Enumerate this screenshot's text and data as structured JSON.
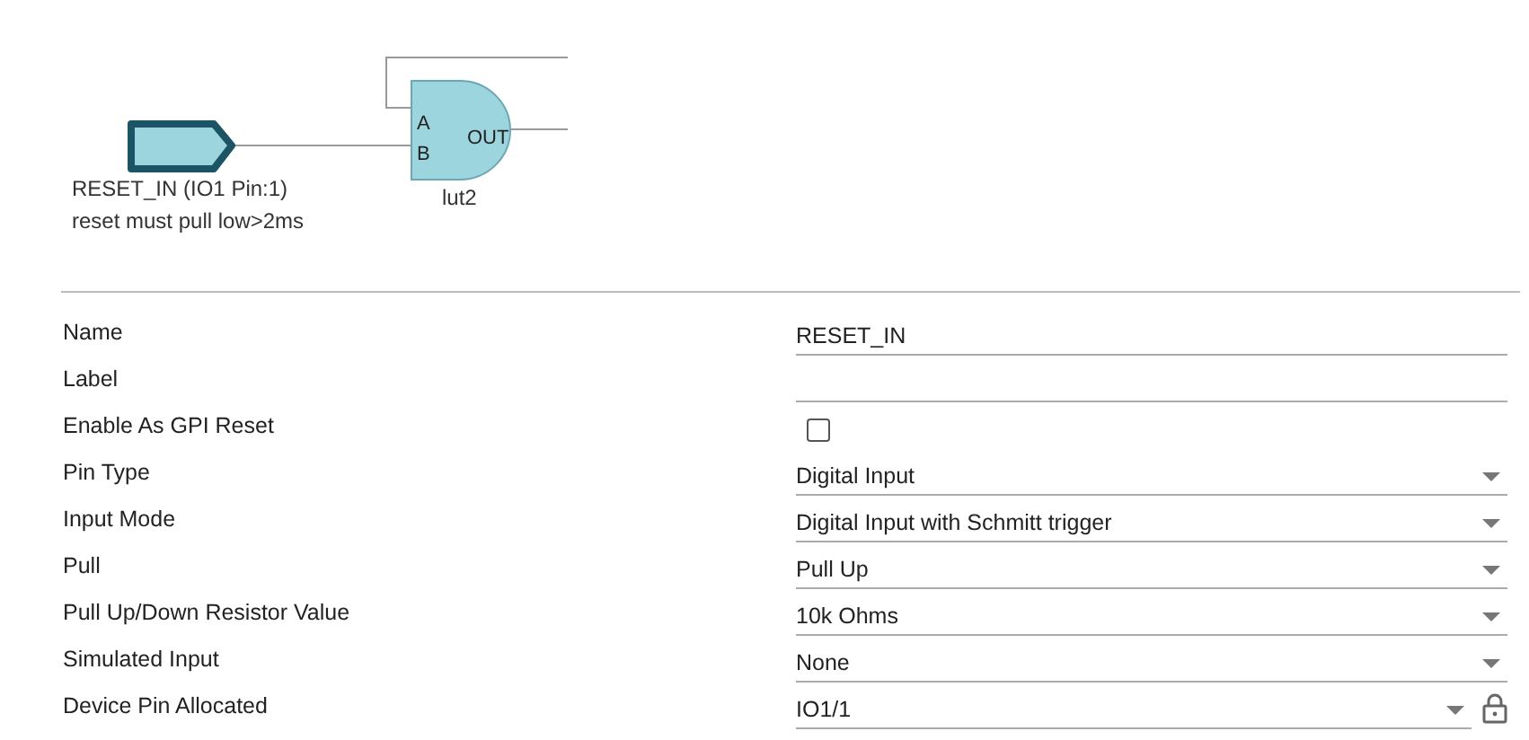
{
  "diagram": {
    "pin": {
      "name": "RESET_IN (IO1 Pin:1)",
      "note": "reset must pull low>2ms"
    },
    "gate": {
      "name": "lut2",
      "inputs": [
        "A",
        "B"
      ],
      "output": "OUT"
    }
  },
  "properties": [
    {
      "kind": "text",
      "label": "Name",
      "value": "RESET_IN"
    },
    {
      "kind": "text",
      "label": "Label"
    },
    {
      "kind": "checkbox",
      "label": "Enable As GPI Reset",
      "checked": false
    },
    {
      "kind": "select",
      "label": "Pin Type",
      "value": "Digital Input"
    },
    {
      "kind": "select",
      "label": "Input Mode",
      "value": "Digital Input with Schmitt trigger"
    },
    {
      "kind": "select",
      "label": "Pull",
      "value": "Pull Up"
    },
    {
      "kind": "select",
      "label": "Pull Up/Down Resistor Value",
      "value": "10k Ohms"
    },
    {
      "kind": "select",
      "label": "Simulated Input",
      "value": "None"
    },
    {
      "kind": "select",
      "label": "Device Pin Allocated",
      "value": "IO1/1",
      "locked": true
    }
  ]
}
